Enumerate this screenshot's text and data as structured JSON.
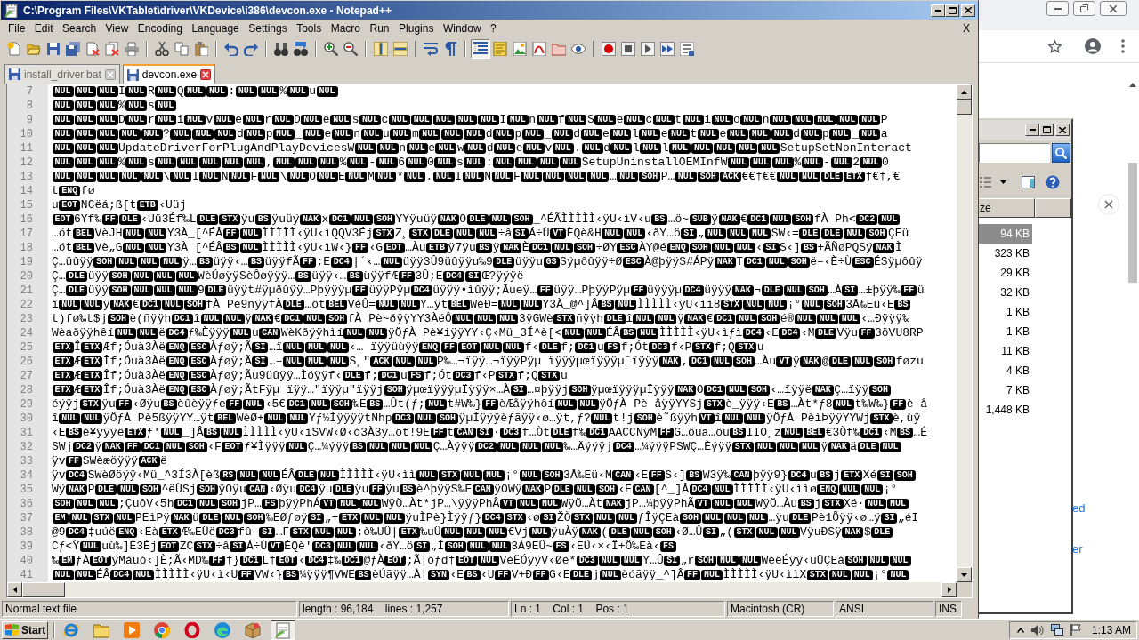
{
  "window": {
    "title": "C:\\Program Files\\VKTablet\\driver\\VKDevice\\i386\\devcon.exe - Notepad++"
  },
  "menu": {
    "items": [
      "File",
      "Edit",
      "Search",
      "View",
      "Encoding",
      "Language",
      "Settings",
      "Tools",
      "Macro",
      "Run",
      "Plugins",
      "Window",
      "?"
    ],
    "close": "X"
  },
  "toolbar": [
    {
      "pressed": false
    },
    {
      "pressed": false
    },
    {
      "pressed": false
    },
    {
      "pressed": false
    },
    {
      "pressed": false
    },
    {
      "pressed": false
    },
    {
      "pressed": false
    },
    {
      "pressed": false
    },
    {
      "pressed": false
    },
    {
      "pressed": false
    },
    {
      "pressed": false
    },
    {
      "pressed": false
    },
    {
      "pressed": false
    },
    {
      "pressed": false
    },
    {
      "pressed": false
    },
    {
      "pressed": false
    },
    {
      "pressed": false
    },
    {
      "pressed": false
    },
    {
      "pressed": false
    },
    {
      "pressed": false
    },
    {
      "pressed": true
    },
    {
      "pressed": false
    },
    {
      "pressed": false
    },
    {
      "pressed": false
    },
    {
      "pressed": false
    },
    {
      "pressed": false
    },
    {
      "pressed": false
    },
    {
      "pressed": false
    },
    {
      "pressed": false
    },
    {
      "pressed": false
    },
    {
      "pressed": false
    }
  ],
  "tabs": [
    {
      "label": "install_driver.bat",
      "selected": false
    },
    {
      "label": "devcon.exe",
      "selected": true
    }
  ],
  "editor": {
    "lines": [
      {
        "number": "7",
        "segments": [
          [
            "NUL",
            "NUL",
            "NUL"
          ],
          "I",
          [
            "NUL"
          ],
          "R",
          [
            "NUL"
          ],
          "Q",
          [
            "NUL",
            "NUL"
          ],
          ":",
          [
            "NUL",
            "NUL"
          ],
          "%",
          [
            "NUL"
          ],
          "u",
          [
            "NUL"
          ]
        ]
      },
      {
        "number": "8",
        "segments": [
          [
            "NUL",
            "NUL",
            "NUL"
          ],
          "%",
          [
            "NUL"
          ],
          "s",
          [
            "NUL"
          ]
        ]
      },
      {
        "number": "9",
        "segments": [
          [
            "NUL",
            "NUL",
            "NUL"
          ],
          "D",
          [
            "NUL"
          ],
          "r",
          [
            "NUL"
          ],
          "i",
          [
            "NUL"
          ],
          "v",
          [
            "NUL"
          ],
          "e",
          [
            "NUL"
          ],
          "r",
          [
            "NUL"
          ],
          "D",
          [
            "NUL"
          ],
          "e",
          [
            "NUL"
          ],
          "s",
          [
            "NUL"
          ],
          "c",
          [
            "NUL",
            "NUL",
            "NUL",
            "NUL",
            "NUL"
          ],
          "I",
          [
            "NUL"
          ],
          "n",
          [
            "NUL"
          ],
          "f",
          [
            "NUL"
          ],
          "S",
          [
            "NUL"
          ],
          "e",
          [
            "NUL"
          ],
          "c",
          [
            "NUL"
          ],
          "t",
          [
            "NUL"
          ],
          "i",
          [
            "NUL"
          ],
          "o",
          [
            "NUL"
          ],
          "n",
          [
            "NUL",
            "NUL",
            "NUL",
            "NUL",
            "NUL"
          ],
          "P"
        ]
      },
      {
        "number": "10",
        "segments": [
          [
            "NUL",
            "NUL",
            "NUL",
            "NUL",
            "NUL"
          ],
          "?",
          [
            "NUL",
            "NUL",
            "NUL"
          ],
          "d",
          [
            "NUL"
          ],
          "p",
          [
            "NUL"
          ],
          "_",
          [
            "NUL"
          ],
          "e",
          [
            "NUL"
          ],
          "n",
          [
            "NUL"
          ],
          "u",
          [
            "NUL"
          ],
          "m",
          [
            "NUL",
            "NUL",
            "NUL"
          ],
          "d",
          [
            "NUL"
          ],
          "p",
          [
            "NUL"
          ],
          "_",
          [
            "NUL"
          ],
          "d",
          [
            "NUL"
          ],
          "e",
          [
            "NUL"
          ],
          "l",
          [
            "NUL"
          ],
          "e",
          [
            "NUL"
          ],
          "t",
          [
            "NUL"
          ],
          "e",
          [
            "NUL",
            "NUL",
            "NUL"
          ],
          "d",
          [
            "NUL"
          ],
          "p",
          [
            "NUL"
          ],
          "_",
          [
            "NUL"
          ],
          "a"
        ]
      },
      {
        "number": "11",
        "segments": [
          [
            "NUL",
            "NUL",
            "NUL"
          ],
          "UpdateDriverForPlugAndPlayDevicesW",
          [
            "NUL",
            "NUL"
          ],
          "n",
          [
            "NUL"
          ],
          "e",
          [
            "NUL"
          ],
          "w",
          [
            "NUL"
          ],
          "d",
          [
            "NUL"
          ],
          "e",
          [
            "NUL"
          ],
          "v",
          [
            "NUL"
          ],
          ".",
          [
            "NUL"
          ],
          "d",
          [
            "NUL"
          ],
          "l",
          [
            "NUL"
          ],
          "l",
          [
            "NUL",
            "NUL",
            "NUL",
            "NUL",
            "NUL"
          ],
          "SetupSetNonInteract"
        ]
      },
      {
        "number": "12",
        "segments": [
          [
            "NUL",
            "NUL",
            "NUL"
          ],
          "%",
          [
            "NUL"
          ],
          "s",
          [
            "NUL",
            "NUL",
            "NUL",
            "NUL",
            "NUL"
          ],
          ",",
          [
            "NUL",
            "NUL",
            "NUL"
          ],
          "%",
          [
            "NUL"
          ],
          "-",
          [
            "NUL"
          ],
          "6",
          [
            "NUL"
          ],
          "0",
          [
            "NUL"
          ],
          "s",
          [
            "NUL"
          ],
          ":",
          [
            "NUL",
            "NUL",
            "NUL",
            "NUL"
          ],
          "SetupUninstallOEMInfW",
          [
            "NUL",
            "NUL",
            "NUL"
          ],
          "%",
          [
            "NUL"
          ],
          "-",
          [
            "NUL"
          ],
          "2",
          [
            "NUL"
          ],
          "0"
        ]
      },
      {
        "number": "13",
        "segments": [
          [
            "NUL",
            "NUL",
            "NUL",
            "NUL",
            "NUL"
          ],
          "\\",
          [
            "NUL"
          ],
          "I",
          [
            "NUL"
          ],
          "N",
          [
            "NUL"
          ],
          "F",
          [
            "NUL"
          ],
          "\\",
          [
            "NUL"
          ],
          "O",
          [
            "NUL"
          ],
          "E",
          [
            "NUL"
          ],
          "M",
          [
            "NUL"
          ],
          "*",
          [
            "NUL"
          ],
          ".",
          [
            "NUL"
          ],
          "I",
          [
            "NUL"
          ],
          "N",
          [
            "NUL"
          ],
          "F",
          [
            "NUL",
            "NUL",
            "NUL",
            "NUL"
          ],
          "…",
          [
            "NUL",
            "SOH"
          ],
          "P…",
          [
            "NUL",
            "SOH",
            "ACK"
          ],
          "€€†€€",
          [
            "NUL",
            "NUL",
            "DLE",
            "ETX"
          ],
          "†€†,€"
        ]
      },
      {
        "number": "14",
        "segments": [
          "t",
          [
            "ENQ"
          ],
          "fø"
        ]
      },
      {
        "number": "15",
        "segments": [
          "u",
          [
            "EOT"
          ],
          "NCëá;ß[t",
          [
            "ETB"
          ],
          "‹Uüj"
        ]
      },
      {
        "number": "16",
        "segments": [
          [
            "EOT"
          ],
          "6Yf‰",
          [
            "FF",
            "DLE"
          ],
          "‹Uü3Éf‰L",
          [
            "DLE",
            "STX"
          ],
          "ÿu",
          [
            "BS"
          ],
          "ÿuüÿ",
          [
            "NAK"
          ],
          "x",
          [
            "DC1",
            "NUL",
            "SOH"
          ],
          "YYÿuüÿ",
          [
            "NAK"
          ],
          "O",
          [
            "DLE",
            "NUL",
            "SOH"
          ],
          "_^ÉÃÌÌÌÌÌ‹ÿU‹ìV‹u",
          [
            "BS"
          ],
          "…ö~",
          [
            "SUB"
          ],
          "ÿ",
          [
            "NAK"
          ],
          "€",
          [
            "DC1",
            "NUL",
            "SOH"
          ],
          "fÀ Ph<",
          [
            "DC2",
            "NUL"
          ]
        ]
      },
      {
        "number": "17",
        "segments": [
          "…öt",
          [
            "BEL"
          ],
          "VèJH",
          [
            "NUL",
            "NUL"
          ],
          "Y3À_[^ÉÂ",
          [
            "FF",
            "NUL"
          ],
          "ÌÌÌÌÌ‹ÿU‹ìQQV3Éj",
          [
            "STX"
          ],
          "Z¸",
          [
            "STX",
            "DLE",
            "NUL",
            "NUL"
          ],
          "÷â",
          [
            "SI"
          ],
          "Á÷Ù",
          [
            "VT"
          ],
          "ÈQè&H",
          [
            "NUL",
            "NUL"
          ],
          "‹ðY…ö",
          [
            "SI"
          ],
          "„",
          [
            "NUL",
            "NUL",
            "NUL"
          ],
          "SW‹=",
          [
            "DLE",
            "DLE",
            "NUL",
            "SOH"
          ],
          "ÇEü"
        ]
      },
      {
        "number": "18",
        "segments": [
          "…öt",
          [
            "BEL"
          ],
          "Vè„G",
          [
            "NUL",
            "NUL"
          ],
          "Y3À_[^ÉÂ",
          [
            "BS",
            "NUL"
          ],
          "ÌÌÌÌÌ‹ÿU‹ìW‹}",
          [
            "FF"
          ],
          "‹G",
          [
            "EOT"
          ],
          "…Àu",
          [
            "ETB"
          ],
          "ÿ7ÿu",
          [
            "BS"
          ],
          "ÿ",
          [
            "NAK"
          ],
          "È",
          [
            "DC1",
            "NUL",
            "SOH"
          ],
          "÷ØY",
          [
            "ESC"
          ],
          "ÀY@é",
          [
            "ENQ",
            "SOH",
            "NUL",
            "NUL"
          ],
          "‹",
          [
            "SI"
          ],
          "S‹]",
          [
            "BS"
          ],
          "+ÃÑøPQSÿ",
          [
            "NAK"
          ],
          "Ì"
        ]
      },
      {
        "number": "19",
        "segments": [
          "Ç…üûÿÿ",
          [
            "SOH",
            "NUL",
            "NUL",
            "NUL"
          ],
          "ÿ…",
          [
            "BS"
          ],
          "üÿÿ‹…",
          [
            "BS"
          ],
          "üÿÿfÃ",
          [
            "FF"
          ],
          ";E",
          [
            "DC4"
          ],
          "|´‹…",
          [
            "NUL"
          ],
          "üÿÿ3Û9üûÿÿu‰9",
          [
            "DLE"
          ],
          "üÿÿu",
          [
            "GS"
          ],
          "Sÿµôûÿÿ÷Ø",
          [
            "ESC"
          ],
          "À@þÿÿS#ÁPÿ",
          [
            "NAK"
          ],
          "T",
          [
            "DC1",
            "NUL",
            "SOH"
          ],
          "ë–‹È÷Ù",
          [
            "ESC"
          ],
          "ÉSÿµôûÿ"
        ]
      },
      {
        "number": "20",
        "segments": [
          "Ç…",
          [
            "DLE"
          ],
          "üÿÿ",
          [
            "SOH",
            "NUL",
            "NUL",
            "NUL"
          ],
          "WèÚøÿÿSèÔøÿÿÿ…",
          [
            "BS"
          ],
          "üÿÿ‹…",
          [
            "BS"
          ],
          "üÿÿfÆ",
          [
            "FF"
          ],
          "3Û;E",
          [
            "DC4",
            "SI"
          ],
          "Œ?ÿÿÿë"
        ]
      },
      {
        "number": "21",
        "segments": [
          "Ç…",
          [
            "DLE"
          ],
          "üÿÿ",
          [
            "SOH",
            "NUL",
            "NUL",
            "NUL"
          ],
          "9",
          [
            "DLE"
          ],
          "üÿÿt#ÿµðûÿÿ…Pþÿÿÿµ",
          [
            "FF"
          ],
          "üÿÿPÿµ",
          [
            "DC4"
          ],
          "üÿÿÿ•ìûÿÿ;Ãueÿ…",
          [
            "FF"
          ],
          "üÿÿ…PþÿÿPÿµ",
          [
            "FF"
          ],
          "üÿÿÿµ",
          [
            "DC4"
          ],
          "üÿÿÿ",
          [
            "NAK"
          ],
          "¬",
          [
            "DLE",
            "NUL",
            "SOH"
          ],
          "…À",
          [
            "SI"
          ],
          "…±þÿÿ‰",
          [
            "FF"
          ],
          "ü"
        ]
      },
      {
        "number": "22",
        "segments": [
          "î",
          [
            "NUL",
            "NUL"
          ],
          "ÿ",
          [
            "NAK"
          ],
          "€",
          [
            "DC1",
            "NUL",
            "SOH"
          ],
          "fÀ Pè9ñÿÿfÀ",
          [
            "DLE"
          ],
          "…öt",
          [
            "BEL"
          ],
          "VèÛ=",
          [
            "NUL",
            "NUL"
          ],
          "Y…ÿt",
          [
            "BEL"
          ],
          "WèÐ=",
          [
            "NUL",
            "NUL"
          ],
          "Y3À_@^]Â",
          [
            "BS",
            "NUL"
          ],
          "ÌÌÌÌÌ‹ÿU‹ìì8",
          [
            "STX",
            "NUL",
            "NUL"
          ],
          "¡°",
          [
            "NUL",
            "SOH"
          ],
          "3Å‰Eü‹E",
          [
            "BS"
          ]
        ]
      },
      {
        "number": "23",
        "segments": [
          "t)fø‰t$j",
          [
            "SOH"
          ],
          "è(ñÿÿh",
          [
            "DC1"
          ],
          "î",
          [
            "NUL",
            "NUL"
          ],
          "ÿ",
          [
            "NAK"
          ],
          "€",
          [
            "DC1",
            "NUL",
            "SOH"
          ],
          "fÀ Pè~ðÿÿYY3ÀéÔ",
          [
            "NUL",
            "NUL",
            "NUL"
          ],
          "3ÿGWè",
          [
            "STX"
          ],
          "ñÿÿh",
          [
            "DLE"
          ],
          "î",
          [
            "NUL",
            "NUL"
          ],
          "ÿ",
          [
            "NAK"
          ],
          "€",
          [
            "DC1",
            "NUL",
            "SOH"
          ],
          "é®",
          [
            "NUL",
            "NUL",
            "NUL"
          ],
          "‹…Ðÿÿÿ‰"
        ]
      },
      {
        "number": "24",
        "segments": [
          "Wèaðÿÿhêí",
          [
            "NUL",
            "NUL"
          ],
          "ë",
          [
            "DC4"
          ],
          "ƒ‰Èÿÿÿ",
          [
            "NUL"
          ],
          "u",
          [
            "CAN"
          ],
          "WèKðÿÿhìí",
          [
            "NUL",
            "NUL"
          ],
          "ÿÖƒÀ Pè¥iÿÿYY‹Ç‹Mü_3Í^è[<",
          [
            "NUL",
            "NUL"
          ],
          "ÉÂ",
          [
            "BS",
            "NUL"
          ],
          "ÌÌÌÌÌ‹ÿU‹ìƒì",
          [
            "DC4"
          ],
          "‹E",
          [
            "DC4"
          ],
          "‹M",
          [
            "DLE"
          ],
          "Vÿu",
          [
            "FF"
          ],
          "3öVU8RP"
        ]
      },
      {
        "number": "25",
        "segments": [
          [
            "ETX"
          ],
          "Î",
          [
            "ETX"
          ],
          "Æf;Óuà3Àë",
          [
            "ENQ",
            "ESC"
          ],
          "Àƒøÿ;Ã",
          [
            "SI"
          ],
          "…ï",
          [
            "NUL",
            "NUL",
            "NUL"
          ],
          "‹… ïÿÿüùÿÿ",
          [
            "ENQ",
            "FF",
            "EOT",
            "NUL",
            "NUL"
          ],
          "f‹",
          [
            "DLE"
          ],
          "f;",
          [
            "DC1"
          ],
          "u",
          [
            "FS"
          ],
          "f;Ót",
          [
            "DC3"
          ],
          "f‹P",
          [
            "STX"
          ],
          "f;Q",
          [
            "STX"
          ],
          "u"
        ]
      },
      {
        "number": "26",
        "segments": [
          [
            "ETX"
          ],
          "Æ",
          [
            "ETX"
          ],
          "Îf;Óuà3Àë",
          [
            "ENQ",
            "ESC"
          ],
          "Àƒøÿ;Ã",
          [
            "SI"
          ],
          "…–",
          [
            "NUL",
            "NUL",
            "NUL"
          ],
          "S¸\"",
          [
            "ACK",
            "NUL",
            "NUL"
          ],
          "P‰…¬ïÿÿ…¬ïÿÿPÿµ ïÿÿÿµœïÿÿÿµˆïÿÿÿ",
          [
            "NAK"
          ],
          ",",
          [
            "DC1",
            "NUL",
            "SOH"
          ],
          "…Àu",
          [
            "VT"
          ],
          "ÿ",
          [
            "NAK"
          ],
          "@",
          [
            "DLE",
            "NUL",
            "SOH"
          ],
          "føzu"
        ]
      },
      {
        "number": "27",
        "segments": [
          [
            "ETX"
          ],
          "Æ",
          [
            "ETX"
          ],
          "Îf;Óuà3Àë",
          [
            "ENQ",
            "ESC"
          ],
          "Àƒøÿ;Ãu9üûÿÿ…Ìóÿÿf‹",
          [
            "DLE"
          ],
          "f;",
          [
            "DC1"
          ],
          "u",
          [
            "FS"
          ],
          "f;Ót",
          [
            "DC3"
          ],
          "f‹P",
          [
            "STX"
          ],
          "f;Q",
          [
            "STX"
          ],
          "u"
        ]
      },
      {
        "number": "28",
        "segments": [
          [
            "ETX"
          ],
          "Æ",
          [
            "ETX"
          ],
          "Îf;Óuà3Àë",
          [
            "ENQ",
            "ESC"
          ],
          "Àƒøÿ;ÃtFÿµ ïÿÿ…\"ïÿÿµ\"ïÿÿj",
          [
            "SOH"
          ],
          "ÿµœïÿÿÿµÏÿÿÿ×…À",
          [
            "SI"
          ],
          "…¤þÿÿj",
          [
            "SOH"
          ],
          "ÿµœïÿÿÿµÏÿÿÿ",
          [
            "NAK"
          ],
          "O",
          [
            "DC1",
            "NUL",
            "SOH"
          ],
          "‹…ïÿÿë",
          [
            "NAK"
          ],
          "Ç…ïÿÿ",
          [
            "SOH"
          ]
        ]
      },
      {
        "number": "29",
        "segments": [
          "éÿÿj",
          [
            "STX"
          ],
          "ÿu",
          [
            "FF"
          ],
          "‹Øÿu",
          [
            "BS"
          ],
          "èûèÿÿƒe",
          [
            "FF",
            "NUL"
          ],
          "‹5€",
          [
            "DC1",
            "NUL",
            "SOH"
          ],
          "‰E",
          [
            "BS"
          ],
          "…Ût(ƒ;",
          [
            "NUL"
          ],
          "t#W‰}",
          [
            "FF"
          ],
          "èÆåÿÿhôí",
          [
            "NUL",
            "NUL"
          ],
          "ÿÖƒÀ Pè åÿÿYYSj",
          [
            "STX"
          ],
          "è_ÿÿÿ‹E",
          [
            "BS"
          ],
          "…Àt*ƒ8",
          [
            "NUL"
          ],
          "t‰W‰}",
          [
            "FF"
          ],
          "è–å"
        ]
      },
      {
        "number": "30",
        "segments": [
          "î",
          [
            "NUL",
            "NUL"
          ],
          "ÿÖƒÀ Pè5ßÿÿYY…ÿt",
          [
            "BEL"
          ],
          "WèØ+",
          [
            "NUL",
            "NUL"
          ],
          "Yƒ½ÌÿÿÿÿtNhp",
          [
            "DC3",
            "NUL",
            "SOH"
          ],
          "ÿµÌÿÿÿèƒãÿÿ‹ø…ÿt,ƒ?",
          [
            "NUL"
          ],
          "t!j",
          [
            "SOH"
          ],
          "è˜ßÿÿh",
          [
            "VT"
          ],
          "î",
          [
            "NUL",
            "NUL"
          ],
          "ÿÖƒÀ PèìÞÿÿYYWj",
          [
            "STX"
          ],
          "è,ùÿ"
        ]
      },
      {
        "number": "31",
        "segments": [
          "‹E",
          [
            "BS"
          ],
          "è¥ÿÿÿë",
          [
            "ETX"
          ],
          "ƒ'",
          [
            "NUL"
          ],
          "_]Â",
          [
            "BS",
            "NUL"
          ],
          "ÌÌÌÌÌ‹ÿU‹ìSVW‹Ø‹ò3À3ÿ…öt!9E",
          [
            "FF"
          ],
          "t",
          [
            "CAN",
            "SI"
          ],
          "·",
          [
            "DC3"
          ],
          "f…Òt",
          [
            "DLE"
          ],
          "f‰",
          [
            "DC1"
          ],
          "AACCNÿM",
          [
            "FF"
          ],
          "G…öuã…öu",
          [
            "BS"
          ],
          "IIO¸z",
          [
            "NUL",
            "BEL"
          ],
          "€3Òf‰",
          [
            "DC1"
          ],
          "‹M",
          [
            "BS"
          ],
          "…É"
        ]
      },
      {
        "number": "32",
        "segments": [
          "SWj",
          [
            "DC2"
          ],
          "ÿ",
          [
            "NAK",
            "FF",
            "DC1",
            "NUL",
            "SOH"
          ],
          "‹F",
          [
            "EOT"
          ],
          "ƒ¥Ìÿÿÿ",
          [
            "NUL"
          ],
          "Ç…¼ýÿÿ",
          [
            "BS",
            "NUL",
            "NUL",
            "NUL"
          ],
          "Ç…Àýÿÿ",
          [
            "DC2",
            "NUL",
            "NUL",
            "NUL"
          ],
          "‰…Äýÿÿj",
          [
            "DC4"
          ],
          "…¼ýÿÿPSWÇ…Èýÿÿ",
          [
            "STX",
            "NUL",
            "NUL",
            "NUL"
          ],
          "ÿ",
          [
            "NAK"
          ],
          "ä",
          [
            "DLE",
            "NUL"
          ]
        ]
      },
      {
        "number": "33",
        "segments": [
          "ÿv",
          [
            "FF"
          ],
          "SWèæöÿÿÿ",
          [
            "ACK"
          ],
          "ë"
        ]
      },
      {
        "number": "34",
        "segments": [
          "ÿv",
          [
            "DC4"
          ],
          "SWèØöÿÿ‹Mü_^3Í3À[èß",
          [
            "RS",
            "NUL",
            "NUL"
          ],
          "ÉÂ",
          [
            "DLE",
            "NUL"
          ],
          "ÌÌÌÌÌ‹ÿU‹ìì",
          [
            "NUL",
            "STX",
            "NUL",
            "NUL"
          ],
          "¡°",
          [
            "NUL",
            "SOH"
          ],
          "3Å‰Eü‹M",
          [
            "CAN"
          ],
          "‹E",
          [
            "FF"
          ],
          "S‹]",
          [
            "BS"
          ],
          "W3ÿ‰",
          [
            "CAN"
          ],
          "þÿÿ9}",
          [
            "DC4"
          ],
          "u",
          [
            "BS"
          ],
          "j",
          [
            "ETX"
          ],
          "Xé",
          [
            "SI",
            "SOH"
          ]
        ]
      },
      {
        "number": "35",
        "segments": [
          "Wÿ",
          [
            "NAK"
          ],
          "P",
          [
            "DLE",
            "NUL",
            "SOH"
          ],
          "^ëÙSj",
          [
            "SOH"
          ],
          "ÿÖÿu",
          [
            "CAN"
          ],
          "‹Øÿu",
          [
            "DC4"
          ],
          "ÿu",
          [
            "DLE"
          ],
          "ÿu",
          [
            "FF"
          ],
          "ÿu",
          [
            "BS"
          ],
          "è^þÿÿS‰E",
          [
            "CAN"
          ],
          "ÿÖWÿ",
          [
            "NAK"
          ],
          "P",
          [
            "DLE",
            "NUL",
            "SOH"
          ],
          "‹E",
          [
            "CAN"
          ],
          "[^_]Â",
          [
            "DC4",
            "NUL"
          ],
          "ÌÌÌÌÌ‹ÿU‹ììø",
          [
            "ENQ",
            "NUL",
            "NUL"
          ],
          "¡°"
        ]
      },
      {
        "number": "36",
        "segments": [
          [
            "SOH",
            "NUL",
            "NUL"
          ],
          ";ÇuôV‹5h",
          [
            "DC1",
            "NUL",
            "SOH"
          ],
          "jP…",
          [
            "FS"
          ],
          "þÿÿPhÁ",
          [
            "VT",
            "NUL",
            "NUL"
          ],
          "WÿÖ…Àt*jP…\\ÿÿÿPhÂ",
          [
            "VT",
            "NUL",
            "NUL"
          ],
          "WÿÖ…Àt",
          [
            "NAK"
          ],
          "jP…¼þÿÿPhÃ",
          [
            "VT",
            "NUL",
            "NUL"
          ],
          "WÿÖ…Àu",
          [
            "BS"
          ],
          "j",
          [
            "STX"
          ],
          "Xé·",
          [
            "NUL",
            "NUL"
          ]
        ]
      },
      {
        "number": "37",
        "segments": [
          [
            "EM",
            "NUL",
            "STX",
            "NUL"
          ],
          "PEìPÿ",
          [
            "NAK"
          ],
          "ü",
          [
            "DLE",
            "NUL",
            "SOH"
          ],
          "‰EØƒøÿ",
          [
            "SI"
          ],
          "„+",
          [
            "ETX",
            "NUL",
            "NUL"
          ],
          "ÿuÌPè}Ìÿÿƒ}",
          [
            "DC4",
            "STX"
          ],
          "‹ø",
          [
            "SI"
          ],
          "ŽÒ",
          [
            "STX",
            "NUL",
            "NUL"
          ],
          "ƒÎÿÇEà",
          [
            "SOH",
            "NUL",
            "NUL",
            "NUL"
          ],
          "…ÿu",
          [
            "DLE"
          ],
          "Pè1Õÿÿ‹ø…ÿ",
          [
            "SI"
          ],
          "„éI"
        ]
      },
      {
        "number": "38",
        "segments": [
          "@9",
          [
            "DC4"
          ],
          "‡uúë",
          [
            "ENQ"
          ],
          "‹Eà",
          [
            "ETX"
          ],
          "Æ‰EÜë",
          [
            "DC3"
          ],
          "fû–",
          [
            "SI"
          ],
          "…F",
          [
            "STX",
            "NUL",
            "NUL"
          ],
          ";ò‰UÜ|",
          [
            "ETX"
          ],
          "‰uÜ",
          [
            "NUL",
            "NUL",
            "NUL"
          ],
          "€Vj",
          [
            "NUL"
          ],
          "ÿuÀÿ",
          [
            "NAK"
          ],
          "(",
          [
            "DLE",
            "NUL",
            "SOH"
          ],
          "‹Ø…Û",
          [
            "SI"
          ],
          "„(",
          [
            "STX",
            "NUL",
            "NUL"
          ],
          "VÿuÐSÿ",
          [
            "NAK"
          ],
          "$",
          [
            "DLE"
          ]
        ]
      },
      {
        "number": "39",
        "segments": [
          "Cƒ<Ÿ",
          [
            "NUL"
          ],
          "uù‰]È3Éj",
          [
            "EOT"
          ],
          "ZC",
          [
            "STX"
          ],
          "÷â",
          [
            "SI"
          ],
          "Á÷Ù",
          [
            "VT"
          ],
          "ÈQè'",
          [
            "DC3",
            "NUL",
            "NUL"
          ],
          "‹ðY…ö",
          [
            "SI"
          ],
          "„Ì",
          [
            "SOH",
            "NUL",
            "NUL"
          ],
          "3À9EÜ~",
          [
            "FS"
          ],
          "‹EÜ‹×‹Î+Ö‰Eà‹",
          [
            "FS"
          ]
        ]
      },
      {
        "number": "40",
        "segments": [
          "‰",
          [
            "EM"
          ],
          "ƒÀ",
          [
            "EOT"
          ],
          "ÿMàuó‹]È;Ã",
          "‹MD‰",
          [
            "FF"
          ],
          "†}",
          [
            "DC1"
          ],
          "L†",
          [
            "EOT"
          ],
          "‹",
          [
            "DC4"
          ],
          "‡‰",
          [
            "DC1"
          ],
          "@ƒÀ",
          [
            "EOT"
          ],
          ";Ã|óƒd†",
          [
            "EOT",
            "NUL"
          ],
          "VèËÓÿÿV‹Øè*",
          [
            "DC3",
            "NUL",
            "NUL"
          ],
          "Y…Û",
          [
            "SI"
          ],
          "„r",
          [
            "SOH",
            "NUL",
            "NUL"
          ],
          "WèêÉÿÿ‹uÜÇEà",
          [
            "SOH",
            "NUL",
            "NUL"
          ]
        ]
      },
      {
        "number": "41",
        "segments": [
          [
            "NUL",
            "NUL"
          ],
          "ÉÂ",
          [
            "DC4",
            "NUL"
          ],
          "ÌÌÌÌÌ‹ÿU‹ì‹U",
          [
            "FF"
          ],
          "VW‹}",
          [
            "BS"
          ],
          "¼ÿÿÿ¶VWE",
          [
            "BS"
          ],
          "èÚãÿÿ…À|",
          [
            "SYN"
          ],
          "‹E",
          [
            "BS"
          ],
          "‹U",
          [
            "FF"
          ],
          "V+Ð",
          [
            "FF"
          ],
          "G‹E",
          [
            "DLE"
          ],
          "j",
          [
            "NUL"
          ],
          "èóãÿÿ_^]Â",
          [
            "FF",
            "NUL"
          ],
          "ÌÌÌÌÌ‹ÿU‹ììX",
          [
            "STX",
            "NUL",
            "NUL"
          ],
          "¡°",
          [
            "NUL"
          ]
        ]
      }
    ]
  },
  "status_bar": [
    "Normal text file",
    "length : 96,184    lines : 1,257",
    "Ln : 1    Col : 1    Pos : 1",
    "Macintosh (CR)",
    "ANSI",
    "INS"
  ],
  "explorer": {
    "column_header": "ze",
    "sizes": [
      {
        "text": "94 KB",
        "selected": true
      },
      {
        "text": "323 KB",
        "selected": false
      },
      {
        "text": "29 KB",
        "selected": false
      },
      {
        "text": "32 KB",
        "selected": false
      },
      {
        "text": "1 KB",
        "selected": false
      },
      {
        "text": "1 KB",
        "selected": false
      },
      {
        "text": "11 KB",
        "selected": false
      },
      {
        "text": "4 KB",
        "selected": false
      },
      {
        "text": "7 KB",
        "selected": false
      },
      {
        "text": "1,448 KB",
        "selected": false
      }
    ]
  },
  "browser": {
    "links": [
      "ed",
      "er"
    ]
  },
  "taskbar": {
    "start": "Start",
    "apps": [
      {
        "active": false
      },
      {
        "active": false
      },
      {
        "active": false
      },
      {
        "active": false
      },
      {
        "active": false
      },
      {
        "active": false
      },
      {
        "active": false
      },
      {
        "active": true
      }
    ],
    "clock": "1:13 AM"
  }
}
